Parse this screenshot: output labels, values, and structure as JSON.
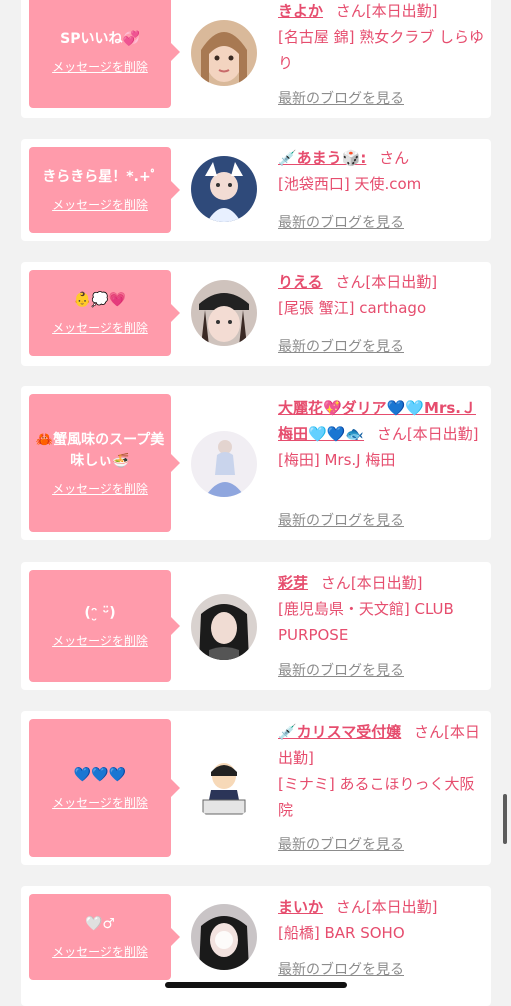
{
  "delete_label": "メッセージを削除",
  "blog_label": "最新のブログを見る",
  "san": "さん",
  "colors": {
    "bubble": "#ff9bab",
    "accent": "#e64d6e",
    "muted": "#8c8c8c"
  },
  "items": [
    {
      "message": "SPいいね💞",
      "name": "きよか",
      "status": "[本日出勤]",
      "shop": "[名古屋 錦] 熟女クラブ しらゆり"
    },
    {
      "message": "きらきら星！*.+ﾟ",
      "name": "💉あまう🎲:",
      "status": "",
      "shop": "[池袋西口] 天使.com"
    },
    {
      "message": "👶💭💗",
      "name": "りえる",
      "status": "[本日出勤]",
      "shop": "[尾張 蟹江] carthago"
    },
    {
      "message": "🦀蟹風味のスープ美味しぃ🍜",
      "name": "大麗花💖ダリア💙🩵Mrs.Ｊ梅田🩵💙🐟",
      "status": "[本日出勤]",
      "shop": "[梅田] Mrs.J 梅田"
    },
    {
      "message": "(ᵔ̮ ᵕ̈)",
      "name": "彩芽",
      "status": "[本日出勤]",
      "shop": "[鹿児島県・天文館] CLUB PURPOSE"
    },
    {
      "message": "💙💙💙",
      "name": "💉カリスマ受付嬢",
      "status": "[本日出勤]",
      "shop": "[ミナミ] あるこほりっく大阪院"
    },
    {
      "message": "🤍♂",
      "name": "まいか",
      "status": "[本日出勤]",
      "shop": "[船橋] BAR SOHO"
    }
  ]
}
